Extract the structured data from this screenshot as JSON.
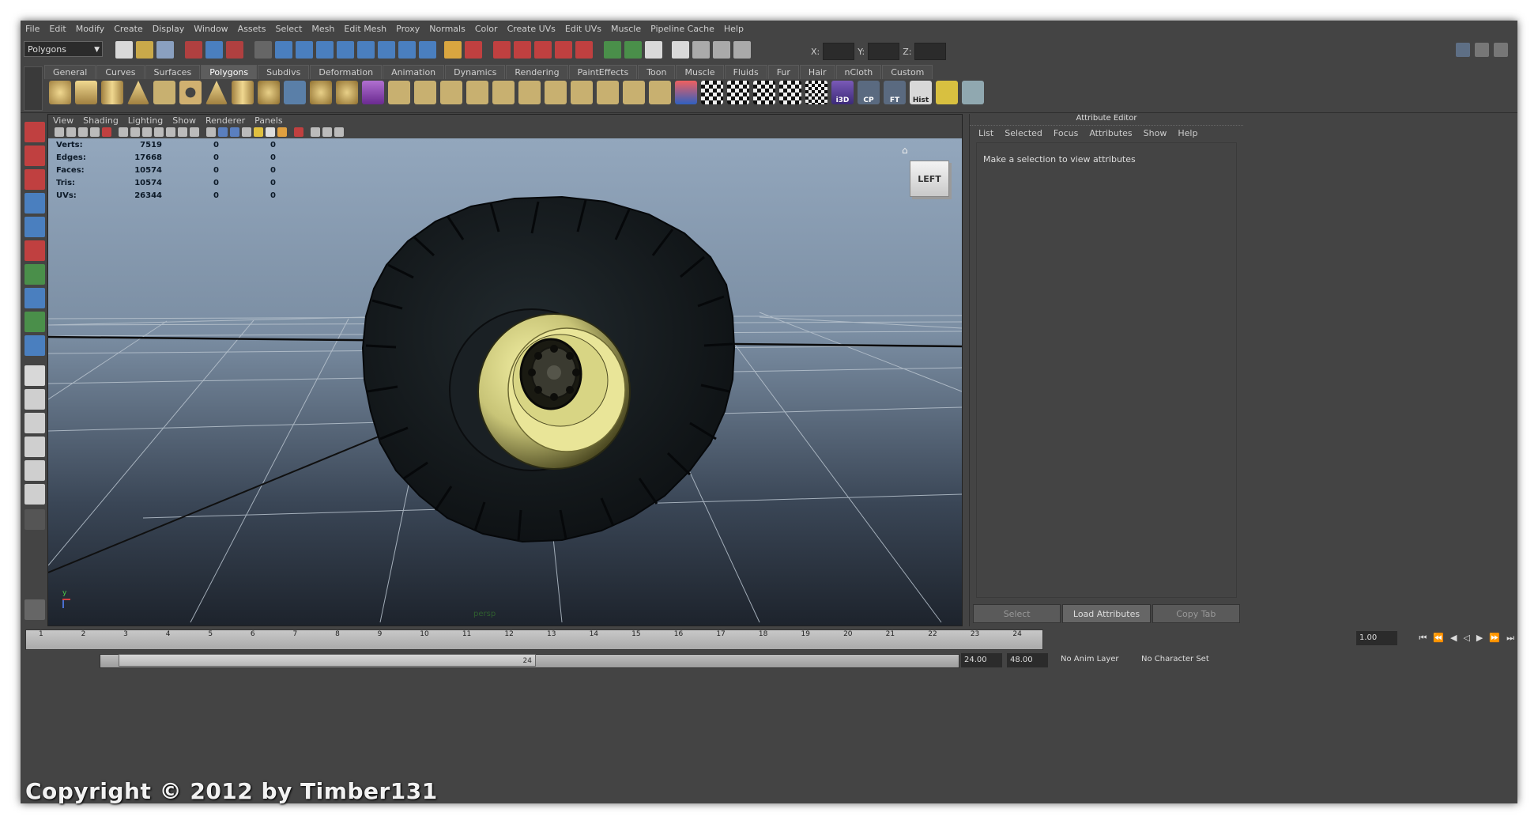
{
  "menu": [
    "File",
    "Edit",
    "Modify",
    "Create",
    "Display",
    "Window",
    "Assets",
    "Select",
    "Mesh",
    "Edit Mesh",
    "Proxy",
    "Normals",
    "Color",
    "Create UVs",
    "Edit UVs",
    "Muscle",
    "Pipeline Cache",
    "Help"
  ],
  "status_line": {
    "mode": "Polygons",
    "x_label": "X:",
    "y_label": "Y:",
    "z_label": "Z:"
  },
  "shelf": {
    "tabs": [
      "General",
      "Curves",
      "Surfaces",
      "Polygons",
      "Subdivs",
      "Deformation",
      "Animation",
      "Dynamics",
      "Rendering",
      "PaintEffects",
      "Toon",
      "Muscle",
      "Fluids",
      "Fur",
      "Hair",
      "nCloth",
      "Custom"
    ],
    "active_tab": "Polygons",
    "text_icons": [
      "i3D",
      "CP",
      "FT",
      "Hist"
    ]
  },
  "panel_menu": [
    "View",
    "Shading",
    "Lighting",
    "Show",
    "Renderer",
    "Panels"
  ],
  "hud": {
    "rows": [
      {
        "label": "Verts:",
        "value": "7519",
        "sel": "0",
        "comp": "0"
      },
      {
        "label": "Edges:",
        "value": "17668",
        "sel": "0",
        "comp": "0"
      },
      {
        "label": "Faces:",
        "value": "10574",
        "sel": "0",
        "comp": "0"
      },
      {
        "label": "Tris:",
        "value": "10574",
        "sel": "0",
        "comp": "0"
      },
      {
        "label": "UVs:",
        "value": "26344",
        "sel": "0",
        "comp": "0"
      }
    ]
  },
  "viewcube_label": "LEFT",
  "camera_label": "persp",
  "axis_label": "y",
  "attribute_editor": {
    "title": "Attribute Editor",
    "menu": [
      "List",
      "Selected",
      "Focus",
      "Attributes",
      "Show",
      "Help"
    ],
    "message": "Make a selection to view attributes",
    "buttons": {
      "select": "Select",
      "load": "Load Attributes",
      "copy": "Copy Tab"
    }
  },
  "timeline": {
    "ticks": [
      "1",
      "2",
      "3",
      "4",
      "5",
      "6",
      "7",
      "8",
      "9",
      "10",
      "11",
      "12",
      "13",
      "14",
      "15",
      "16",
      "17",
      "18",
      "19",
      "20",
      "21",
      "22",
      "23",
      "24"
    ],
    "current_frame": "1.00"
  },
  "range": {
    "handle_end": "24",
    "end_time": "24.00",
    "max_time": "48.00",
    "anim_layer": "No Anim Layer",
    "character_set": "No Character Set"
  },
  "watermark": "Copyright © 2012 by Timber131"
}
